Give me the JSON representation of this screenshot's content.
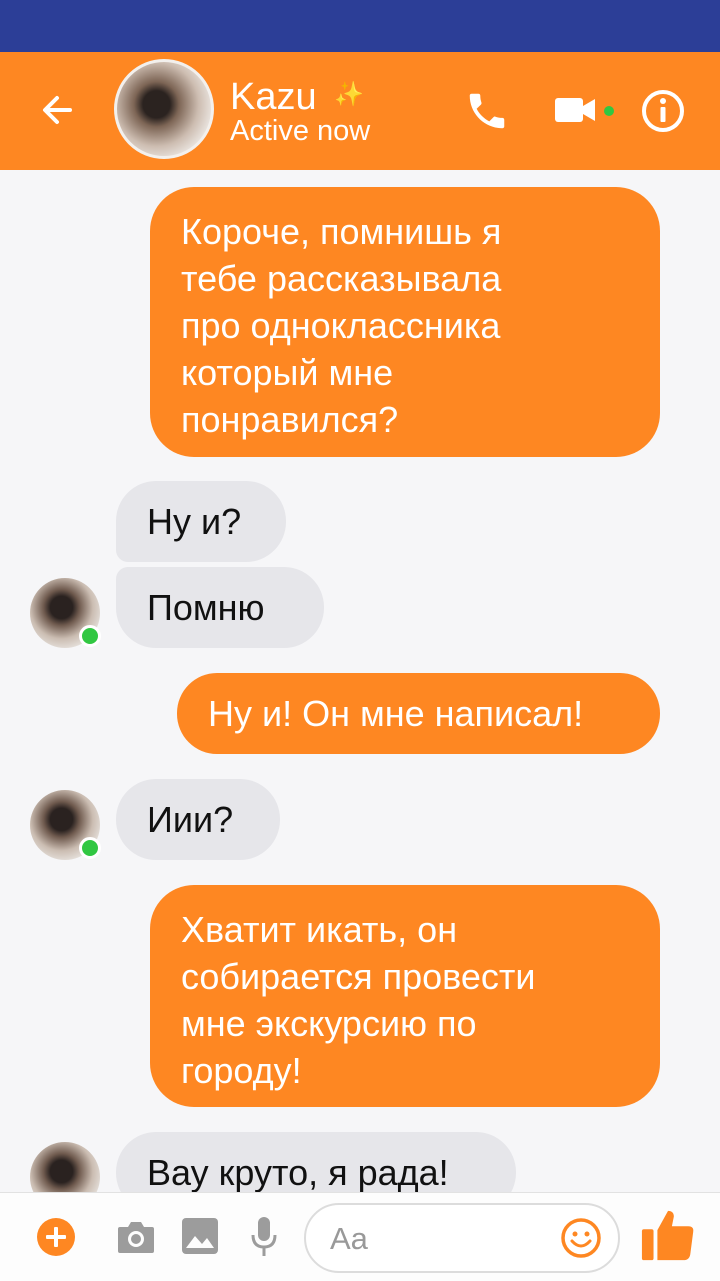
{
  "header": {
    "contact_name": "Kazu",
    "sparkle": "✨",
    "status": "Active now"
  },
  "messages": [
    {
      "side": "outgoing",
      "text": "Короче, помнишь я тебе рассказывала про одноклассника который мне понравился?",
      "lines": [
        "Короче, помнишь я",
        "тебе рассказывала",
        "про одноклассника",
        "который мне",
        "понравился?"
      ]
    },
    {
      "side": "incoming",
      "text": "Ну и?"
    },
    {
      "side": "incoming",
      "text": "Помню"
    },
    {
      "side": "outgoing",
      "text": "Ну и! Он мне написал!"
    },
    {
      "side": "incoming",
      "text": "Иии?"
    },
    {
      "side": "outgoing",
      "text": "Хватит икать, он собирается провести мне экскурсию по городу!",
      "lines": [
        "Хватит икать, он",
        "собирается провести",
        "мне экскурсию по",
        "городу!"
      ]
    },
    {
      "side": "incoming",
      "text": "Вау круто, я рада!"
    }
  ],
  "composer": {
    "placeholder": "Aa",
    "icons": [
      "plus-icon",
      "camera-icon",
      "gallery-icon",
      "microphone-icon",
      "emoji-icon",
      "thumbs-up-icon"
    ]
  },
  "colors": {
    "accent": "#fe8722",
    "status_bar": "#2c3e97",
    "incoming_bubble": "#e6e6ea",
    "background": "#f6f6f8",
    "presence": "#31c742"
  }
}
